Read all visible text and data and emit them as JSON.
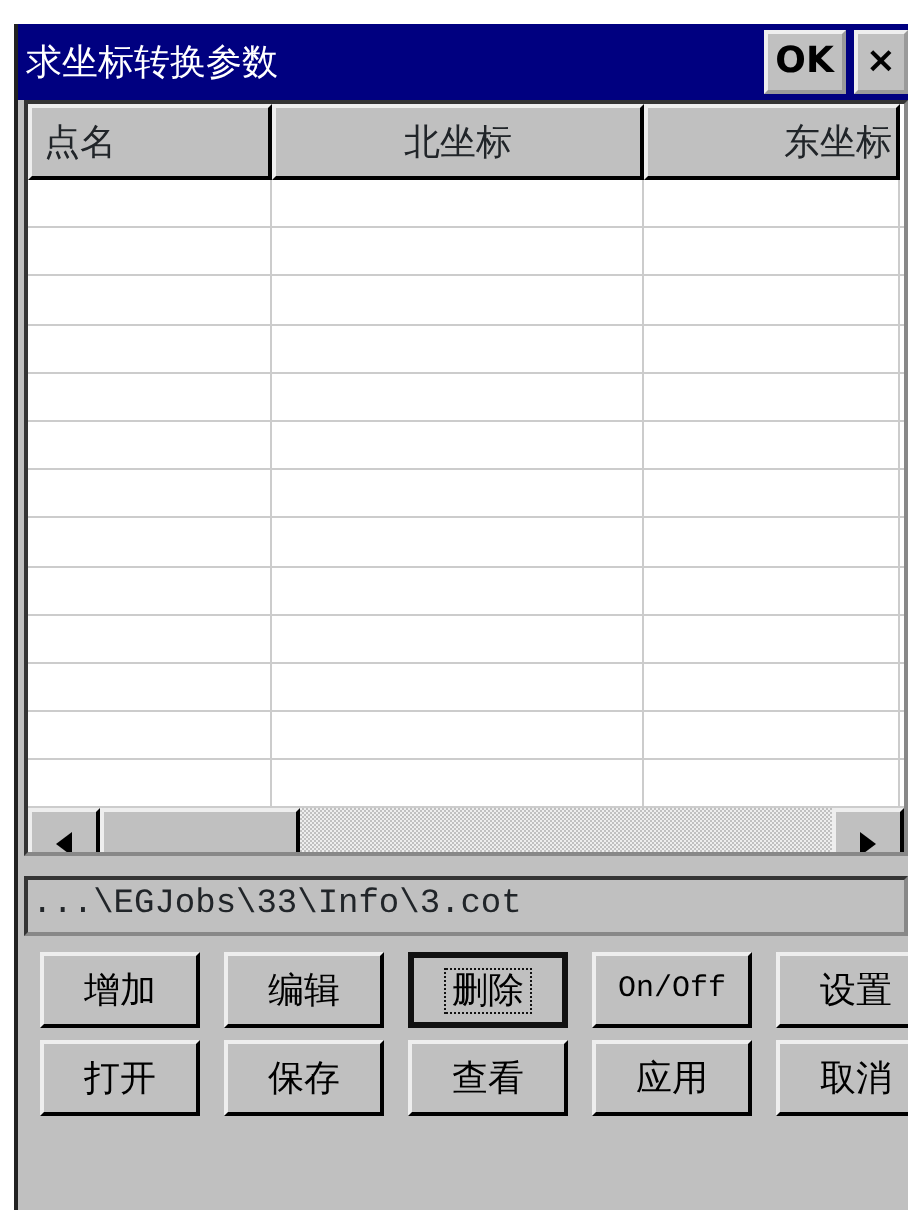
{
  "window": {
    "title": "求坐标转换参数",
    "ok_button": "OK",
    "close_button": "×"
  },
  "table": {
    "columns": [
      "点名",
      "北坐标",
      "东坐标"
    ]
  },
  "path_field": {
    "value": "...\\EGJobs\\33\\Info\\3.cot"
  },
  "buttons": [
    {
      "label": "增加",
      "focused": false
    },
    {
      "label": "编辑",
      "focused": false
    },
    {
      "label": "删除",
      "focused": true
    },
    {
      "label": "On/Off",
      "focused": false
    },
    {
      "label": "设置",
      "focused": false
    },
    {
      "label": "打开",
      "focused": false
    },
    {
      "label": "保存",
      "focused": false
    },
    {
      "label": "查看",
      "focused": false
    },
    {
      "label": "应用",
      "focused": false
    },
    {
      "label": "取消",
      "focused": false
    }
  ]
}
